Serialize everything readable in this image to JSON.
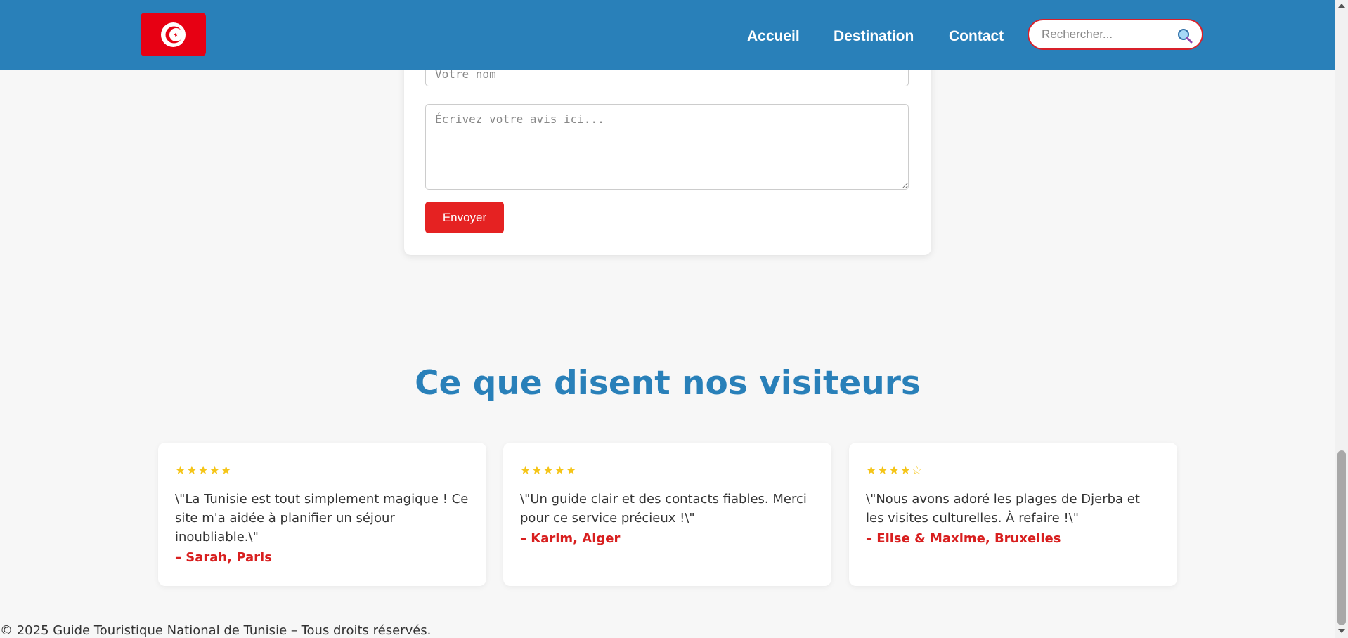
{
  "header": {
    "logo_alt": "Tunisia flag",
    "nav": [
      "Accueil",
      "Destination",
      "Contact"
    ],
    "search_placeholder": "Rechercher..."
  },
  "form": {
    "name_placeholder": "Votre nom",
    "review_placeholder": "Écrivez votre avis ici...",
    "submit_label": "Envoyer"
  },
  "testimonials": {
    "title": "Ce que disent nos visiteurs",
    "items": [
      {
        "stars": "★★★★★",
        "rating": 5,
        "quote": "\\\"La Tunisie est tout simplement magique ! Ce site m'a aidée à planifier un séjour inoubliable.\\\"",
        "author": "– Sarah, Paris"
      },
      {
        "stars": "★★★★★",
        "rating": 5,
        "quote": "\\\"Un guide clair et des contacts fiables. Merci pour ce service précieux !\\\"",
        "author": "– Karim, Alger"
      },
      {
        "stars": "★★★★☆",
        "rating": 4,
        "quote": "\\\"Nous avons adoré les plages de Djerba et les visites culturelles. À refaire !\\\"",
        "author": "– Elise & Maxime, Bruxelles"
      }
    ]
  },
  "footer": {
    "text": "© 2025 Guide Touristique National de Tunisie – Tous droits réservés."
  },
  "colors": {
    "header_bg": "#2980b9",
    "accent_red": "#e52222",
    "star_gold": "#f5c518",
    "page_bg": "#f7f7f7"
  },
  "icons": [
    "tunisia-flag-icon",
    "search-icon"
  ]
}
